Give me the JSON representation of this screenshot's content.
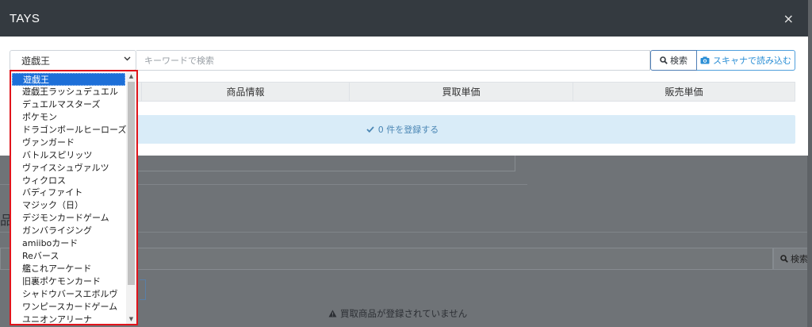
{
  "background": {
    "heading_fragment": "品",
    "search_button": "検索",
    "empty_message": "買取商品が登録されていません"
  },
  "modal": {
    "title": "TAYS",
    "close": "×",
    "category_select": {
      "value": "遊戯王"
    },
    "keyword_input": {
      "placeholder": "キーワードで検索"
    },
    "search_button": "検索",
    "scan_button": "スキャナで読み込む",
    "table_headers": [
      "",
      "商品情報",
      "買取単価",
      "販売単価"
    ],
    "register_button": "0 件を登録する"
  },
  "dropdown": {
    "selected_index": 0,
    "options": [
      "遊戯王",
      "遊戯王ラッシュデュエル",
      "デュエルマスターズ",
      "ポケモン",
      "ドラゴンボールヒーローズ",
      "ヴァンガード",
      "バトルスピリッツ",
      "ヴァイスシュヴァルツ",
      "ウィクロス",
      "バディファイト",
      "マジック（日）",
      "デジモンカードゲーム",
      "ガンバライジング",
      "amiiboカード",
      "Reバース",
      "艦これアーケード",
      "旧裏ポケモンカード",
      "シャドウバースエボルヴ",
      "ワンピースカードゲーム",
      "ユニオンアリーナ"
    ]
  },
  "colors": {
    "header_bg": "#343a40",
    "accent_blue": "#2b8fd6",
    "highlight_red": "#e0141b",
    "selected_bg": "#1d6fd8"
  }
}
